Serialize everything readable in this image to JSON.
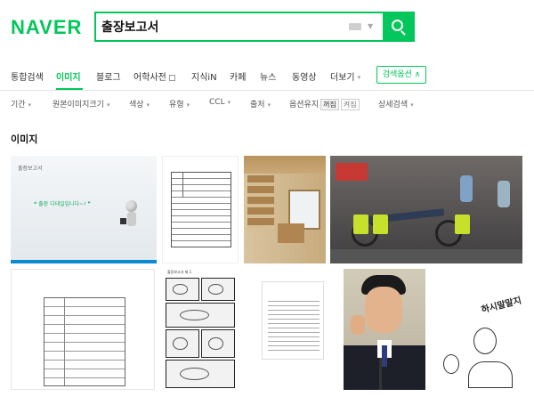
{
  "header": {
    "logo": "NAVER",
    "search_value": "출장보고서",
    "brand_color": "#03c75a"
  },
  "tabs": [
    {
      "label": "통합검색",
      "active": false
    },
    {
      "label": "이미지",
      "active": true
    },
    {
      "label": "블로그",
      "active": false
    },
    {
      "label": "어학사전",
      "active": false
    },
    {
      "label": "지식iN",
      "active": false
    },
    {
      "label": "카페",
      "active": false
    },
    {
      "label": "뉴스",
      "active": false
    },
    {
      "label": "동영상",
      "active": false
    },
    {
      "label": "더보기",
      "active": false
    }
  ],
  "search_options_label": "검색옵션",
  "filters": {
    "period": "기간",
    "size": "원본이미지크기",
    "color": "색상",
    "type": "유형",
    "ccl": "CCL",
    "source": "출처",
    "option_keep": "옵션유지",
    "keep_on": "꺼짐",
    "keep_off": "켜짐",
    "detail": "상세검색"
  },
  "section_title": "이미지",
  "images": {
    "img1_label": "출장보고서",
    "img1_quote": "❝ 출장 디테일입니다~! ❞",
    "img6_caption": "출장보고서 제 1",
    "img9_text": "하시말말지"
  },
  "icons": {
    "search": "magnifier-icon",
    "keyboard": "keyboard-icon",
    "dropdown": "caret-down-icon",
    "chevron_up": "chevron-up-icon"
  }
}
